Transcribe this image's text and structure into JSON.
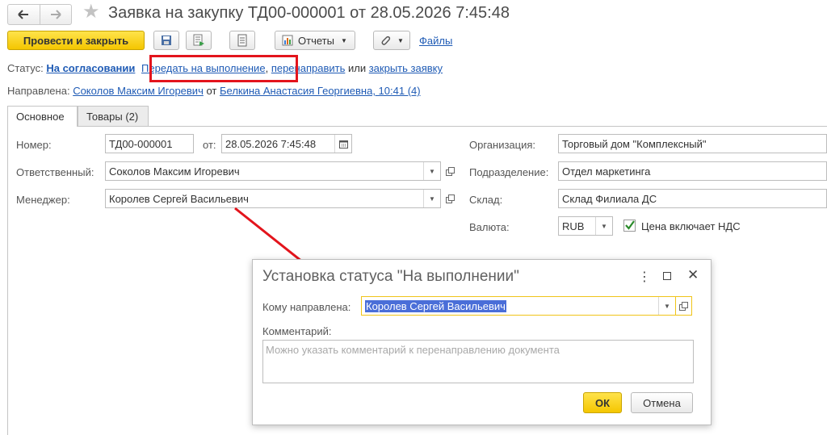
{
  "window": {
    "title": "Заявка на закупку ТД00-000001 от 28.05.2026 7:45:48"
  },
  "toolbar": {
    "post_close_label": "Провести и закрыть",
    "reports_label": "Отчеты",
    "files_label": "Файлы"
  },
  "status_line": {
    "label": "Статус:",
    "current_status": "На согласовании",
    "action_execute": "Передать на выполнение",
    "comma": ",",
    "action_redirect": "перенаправить",
    "or_text": "или",
    "action_close": "закрыть заявку"
  },
  "directed_line": {
    "label": "Направлена:",
    "to": "Соколов Максим Игоревич",
    "from_text": "от",
    "from": "Белкина Анастасия Георгиевна, 10:41 (4)"
  },
  "tabs": [
    {
      "label": "Основное",
      "active": true
    },
    {
      "label": "Товары (2)",
      "active": false
    }
  ],
  "form": {
    "number_label": "Номер:",
    "number_value": "ТД00-000001",
    "date_label": "от:",
    "date_value": "28.05.2026  7:45:48",
    "responsible_label": "Ответственный:",
    "responsible_value": "Соколов Максим Игоревич",
    "manager_label": "Менеджер:",
    "manager_value": "Королев Сергей Васильевич",
    "organization_label": "Организация:",
    "organization_value": "Торговый дом \"Комплексный\"",
    "department_label": "Подразделение:",
    "department_value": "Отдел маркетинга",
    "warehouse_label": "Склад:",
    "warehouse_value": "Склад Филиала ДС",
    "currency_label": "Валюта:",
    "currency_value": "RUB",
    "vat_label": "Цена включает НДС",
    "vat_checked": true
  },
  "dialog": {
    "title": "Установка статуса \"На выполнении\"",
    "recipient_label": "Кому направлена:",
    "recipient_value": "Королев Сергей Васильевич",
    "comment_label": "Комментарий:",
    "comment_placeholder": "Можно указать комментарий к перенаправлению документа",
    "ok_label": "ОК",
    "cancel_label": "Отмена"
  },
  "colors": {
    "accent_yellow": "#f4c600",
    "link_blue": "#1f5bb5",
    "highlight_red": "#e3141c",
    "selection_blue": "#4a6ed8"
  },
  "icons": [
    "back-arrow-icon",
    "forward-arrow-icon",
    "star-icon",
    "save-icon",
    "post-icon",
    "list-icon",
    "reports-icon",
    "paperclip-icon",
    "calendar-icon",
    "open-icon",
    "more-icon",
    "maximize-icon",
    "close-icon"
  ]
}
